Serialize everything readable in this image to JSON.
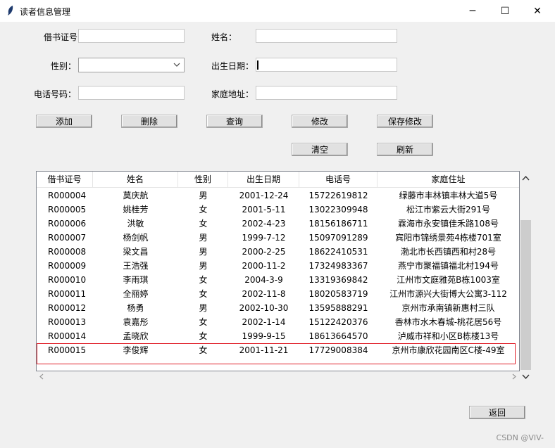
{
  "window": {
    "title": "读者信息管理",
    "minimize_glyph": "─",
    "maximize_glyph": "☐",
    "close_glyph": "✕"
  },
  "form": {
    "card_label": "借书证号",
    "name_label": "姓名：",
    "gender_label": "性别：",
    "birth_label": "出生日期：",
    "phone_label": "电话号码：",
    "address_label": "家庭地址：",
    "card_value": "",
    "name_value": "",
    "gender_value": "",
    "birth_value": "",
    "phone_value": "",
    "address_value": ""
  },
  "buttons": {
    "add": "添加",
    "delete": "删除",
    "query": "查询",
    "modify": "修改",
    "save": "保存修改",
    "clear": "清空",
    "refresh": "刷新",
    "back": "返回"
  },
  "table": {
    "columns": [
      "借书证号",
      "姓名",
      "性别",
      "出生日期",
      "电话号",
      "家庭住址"
    ],
    "rows": [
      [
        "R000004",
        "莫庆航",
        "男",
        "2001-12-24",
        "15722619812",
        "绿藤市丰林镇丰林大道5号"
      ],
      [
        "R000005",
        "姚桂芳",
        "女",
        "2001-5-11",
        "13022309948",
        "松江市紫云大街291号"
      ],
      [
        "R000006",
        "洪敏",
        "女",
        "2002-4-23",
        "18156186711",
        "霖海市永安镇佳禾路108号"
      ],
      [
        "R000007",
        "杨剑帆",
        "男",
        "1999-7-12",
        "15097091289",
        "宾阳市锦绣景苑4栋楼701室"
      ],
      [
        "R000008",
        "梁文昌",
        "男",
        "2000-2-25",
        "18622410531",
        "渤北市长西镇西和村28号"
      ],
      [
        "R000009",
        "王浩强",
        "男",
        "2000-11-2",
        "17324983367",
        "燕宁市聚福镇福北村194号"
      ],
      [
        "R000010",
        "李雨琪",
        "女",
        "2004-3-9",
        "13319369842",
        "江州市文庭雅苑B栋1003室"
      ],
      [
        "R000011",
        "全丽婷",
        "女",
        "2002-11-8",
        "18020583719",
        "江州市源兴大街博大公寓3-112"
      ],
      [
        "R000012",
        "杨勇",
        "男",
        "2002-10-30",
        "13595888291",
        "京州市承南镇新惠村三队"
      ],
      [
        "R000013",
        "袁嘉彤",
        "女",
        "2002-1-14",
        "15122420376",
        "香林市水木春城-桃花居56号"
      ],
      [
        "R000014",
        "孟晓欣",
        "女",
        "1999-9-15",
        "18613664570",
        "泸威市祥和小区B栋楼13号"
      ],
      [
        "R000015",
        "李俊辉",
        "女",
        "2001-11-21",
        "17729008384",
        "京州市康欣花园南区C楼-49室"
      ]
    ]
  },
  "footer": {
    "watermark": "CSDN @VIV-"
  },
  "colors": {
    "highlight_border": "#e0202a",
    "window_bg": "#f0f0f0"
  }
}
